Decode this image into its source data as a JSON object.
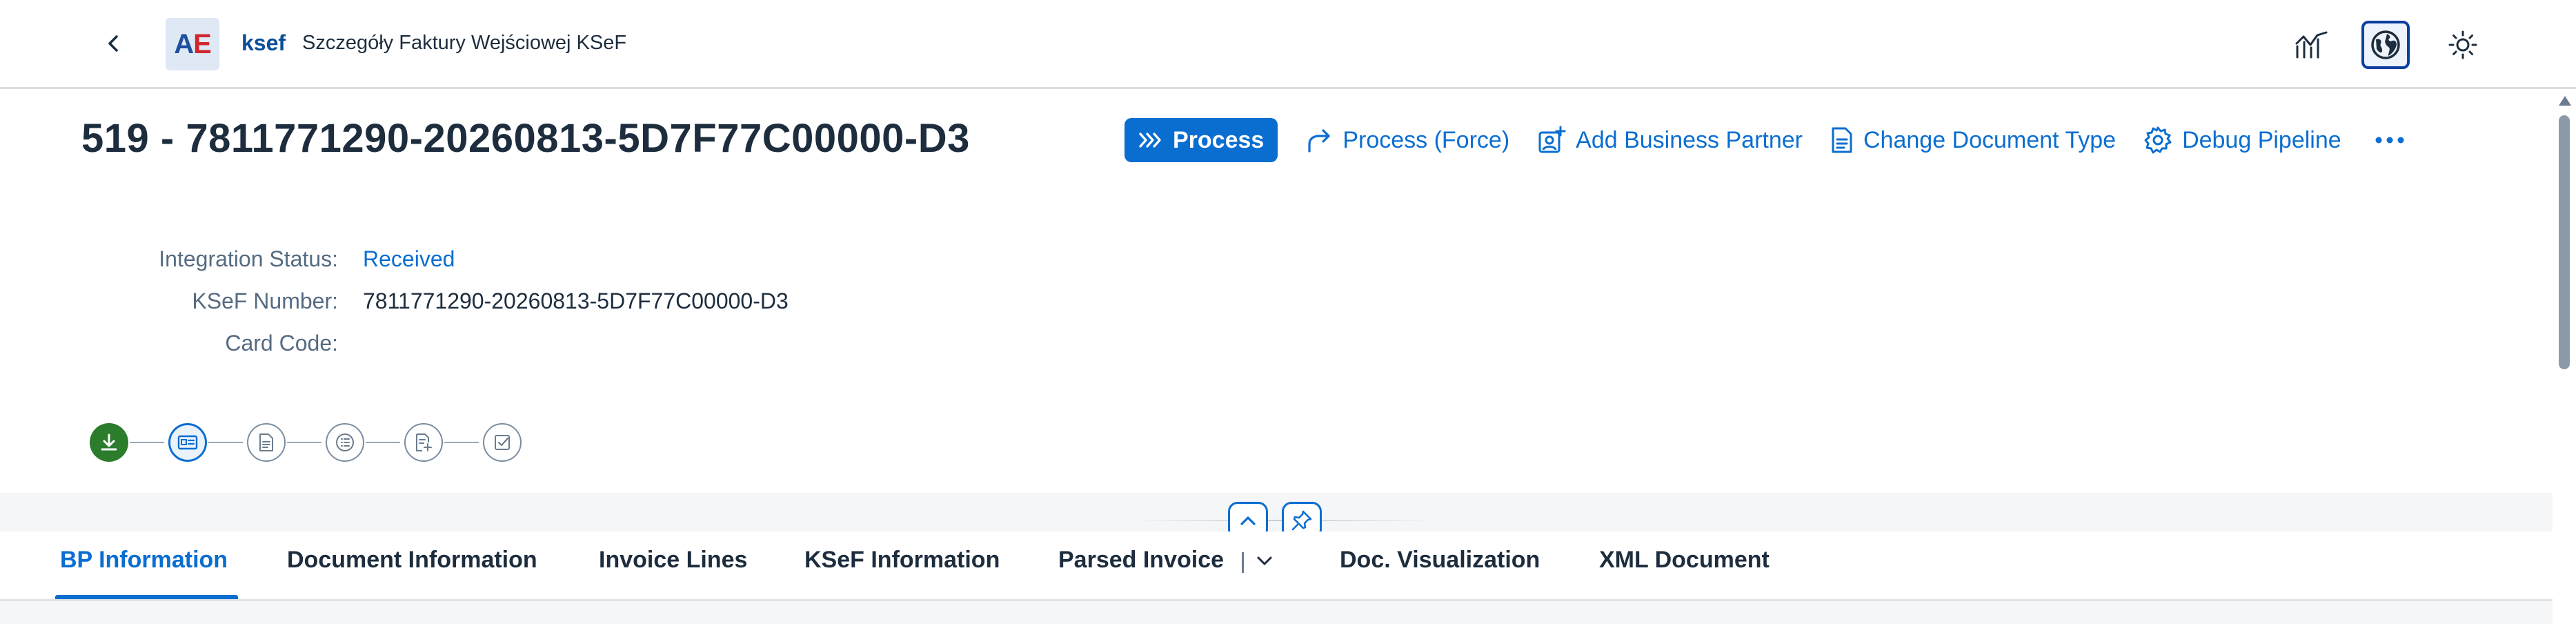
{
  "shell": {
    "logo_text_a": "A",
    "logo_text_e": "E",
    "app_name": "ksef",
    "app_subtitle": "Szczegóły Faktury Wejściowej KSeF",
    "icons": [
      "back-icon",
      "analytics-icon",
      "globe-icon",
      "sun-icon"
    ]
  },
  "header": {
    "title": "519 - 7811771290-20260813-5D7F77C00000-D3",
    "actions": {
      "process": "Process",
      "process_force": "Process (Force)",
      "add_bp": "Add Business Partner",
      "change_doc_type": "Change Document Type",
      "debug_pipeline": "Debug Pipeline"
    },
    "attributes": [
      {
        "label": "Integration Status:",
        "value": "Received"
      },
      {
        "label": "KSeF Number:",
        "value": "7811771290-20260813-5D7F77C00000-D3"
      },
      {
        "label": "Card Code:",
        "value": ""
      }
    ]
  },
  "process_flow": {
    "steps": [
      {
        "icon": "download-icon",
        "state": "done"
      },
      {
        "icon": "id-card-icon",
        "state": "current"
      },
      {
        "icon": "document-icon",
        "state": "todo"
      },
      {
        "icon": "list-icon",
        "state": "todo"
      },
      {
        "icon": "document-add-icon",
        "state": "todo"
      },
      {
        "icon": "checkbox-icon",
        "state": "todo"
      }
    ]
  },
  "tabs": [
    {
      "label": "BP Information",
      "selected": true
    },
    {
      "label": "Document Information",
      "selected": false
    },
    {
      "label": "Invoice Lines",
      "selected": false
    },
    {
      "label": "KSeF Information",
      "selected": false
    },
    {
      "label": "Parsed Invoice",
      "selected": false
    },
    {
      "label": "Doc. Visualization",
      "selected": false
    },
    {
      "label": "XML Document",
      "selected": false
    }
  ],
  "colors": {
    "accent": "#0a6ed1",
    "success": "#2b7c2b",
    "text": "#1d2d3e",
    "label": "#556b82"
  }
}
